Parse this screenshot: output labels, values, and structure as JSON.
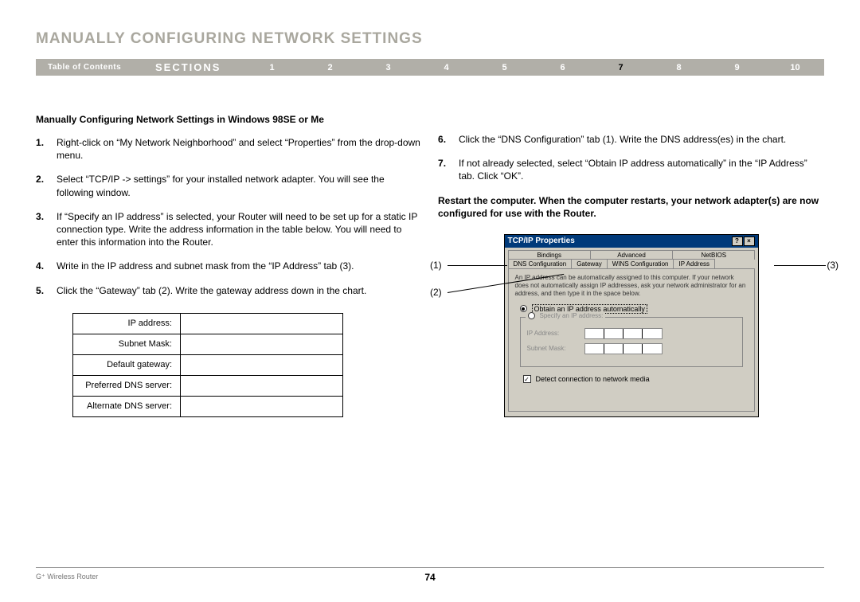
{
  "header": {
    "title": "Manually Configuring Network Settings"
  },
  "nav": {
    "toc": "Table of Contents",
    "sections_label": "SECTIONS",
    "numbers": [
      "1",
      "2",
      "3",
      "4",
      "5",
      "6",
      "7",
      "8",
      "9",
      "10"
    ],
    "current": "7"
  },
  "subtitle": "Manually Configuring Network Settings in Windows 98SE or Me",
  "steps_left": [
    "Right-click on “My Network Neighborhood” and select “Properties” from the drop-down menu.",
    "Select “TCP/IP -> settings” for your installed network adapter. You will see the following window.",
    "If “Specify an IP address” is selected, your Router will need to be set up for a static IP connection type. Write the address information in the table below. You will need to enter this information into the Router.",
    "Write in the IP address and subnet mask from the “IP Address” tab (3).",
    "Click the “Gateway” tab (2). Write the gateway address down in the chart."
  ],
  "steps_right": [
    "Click the “DNS Configuration” tab (1). Write the DNS address(es) in the chart.",
    "If not already selected, select “Obtain IP address automatically” in the “IP Address” tab. Click “OK”."
  ],
  "restart_note": "Restart the computer. When the computer restarts, your network adapter(s) are now configured for use with the Router.",
  "form_rows": [
    "IP address:",
    "Subnet Mask:",
    "Default gateway:",
    "Preferred DNS server:",
    "Alternate DNS server:"
  ],
  "dialog": {
    "title": "TCP/IP Properties",
    "help_btn": "?",
    "close_btn": "×",
    "tabs_row1": [
      "Bindings",
      "Advanced",
      "NetBIOS"
    ],
    "tabs_row2": [
      "DNS Configuration",
      "Gateway",
      "WINS Configuration",
      "IP Address"
    ],
    "body_text": "An IP address can be automatically assigned to this computer. If your network does not automatically assign IP addresses, ask your network administrator for an address, and then type it in the space below.",
    "radio_obtain": "Obtain an IP address automatically",
    "radio_specify": "Specify an IP address:",
    "ip_label": "IP Address:",
    "subnet_label": "Subnet Mask:",
    "detect_label": "Detect connection to network media"
  },
  "callouts": {
    "c1": "(1)",
    "c2": "(2)",
    "c3": "(3)"
  },
  "footer": {
    "product": "G⁺ Wireless Router",
    "page_number": "74"
  }
}
